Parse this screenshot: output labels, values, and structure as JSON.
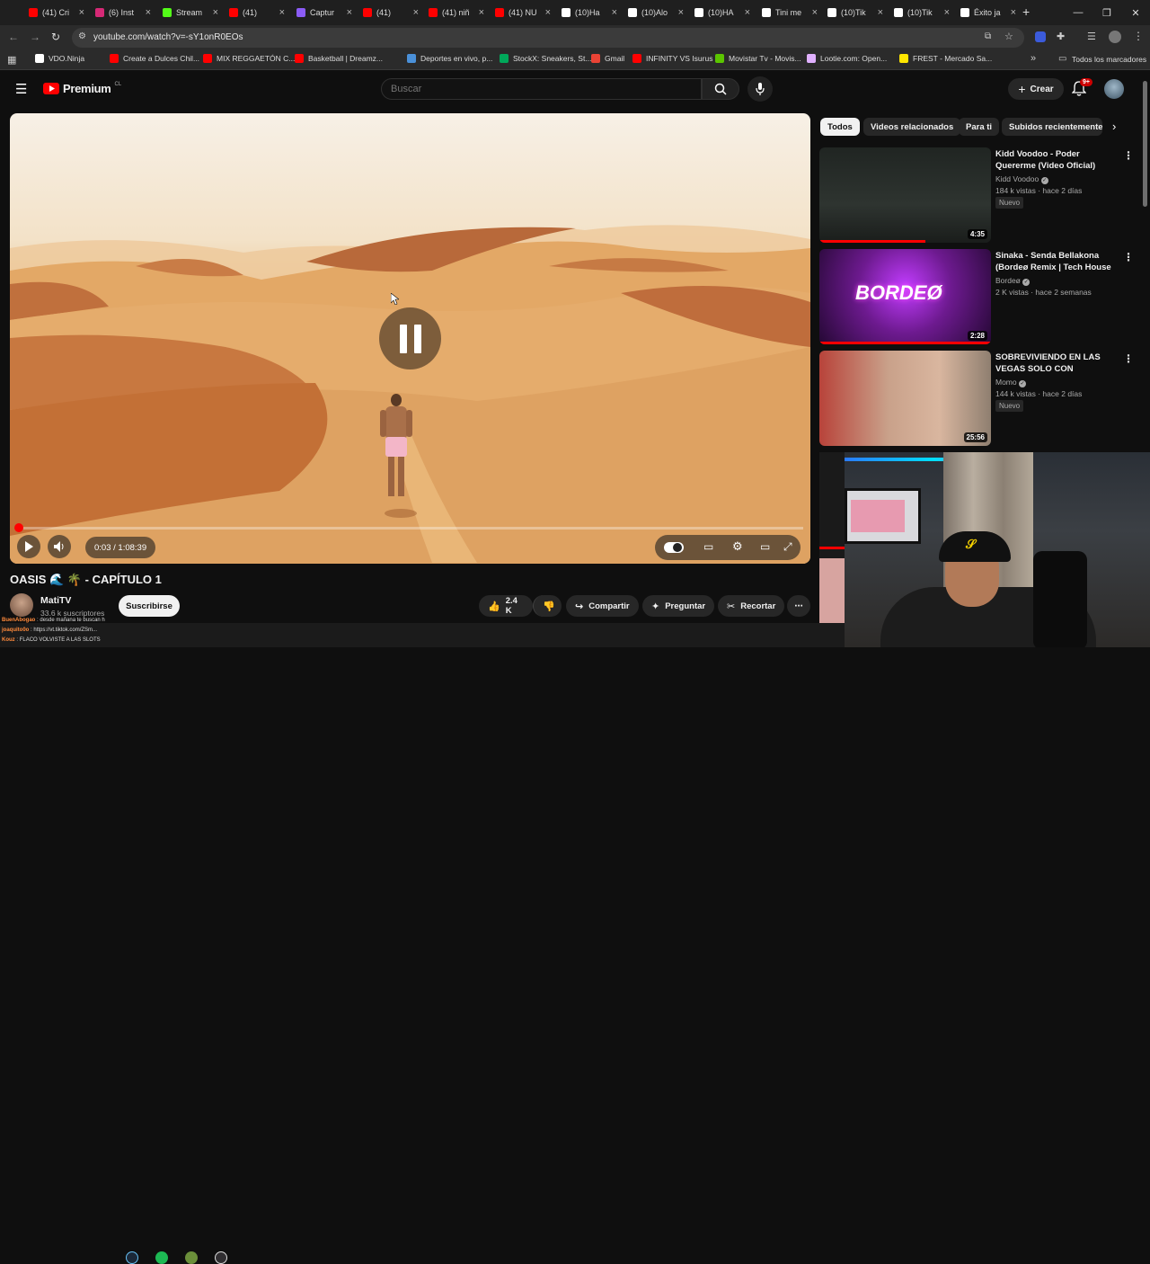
{
  "browser": {
    "tabs": [
      {
        "label": "(41) Cri",
        "color": "#ff0000"
      },
      {
        "label": "(6) Inst",
        "color": "#d62976"
      },
      {
        "label": "Stream",
        "color": "#53fc18"
      },
      {
        "label": "(41)",
        "color": "#ff0000"
      },
      {
        "label": "Captur",
        "color": "#8b5cf6"
      },
      {
        "label": "(41)",
        "color": "#ff0000"
      },
      {
        "label": "(41) niñ",
        "color": "#ff0000"
      },
      {
        "label": "(41) NU",
        "color": "#ff0000"
      },
      {
        "label": "(10)Ha",
        "color": "#ffffff"
      },
      {
        "label": "(10)Alo",
        "color": "#ffffff"
      },
      {
        "label": "(10)HA",
        "color": "#ffffff"
      },
      {
        "label": "Tini me",
        "color": "#ffffff"
      },
      {
        "label": "(10)Tik",
        "color": "#ffffff"
      },
      {
        "label": "(10)Tik",
        "color": "#ffffff"
      },
      {
        "label": "Éxito ja",
        "color": "#ffffff"
      }
    ],
    "new_tab": "+",
    "url": "youtube.com/watch?v=-sY1onR0EOs",
    "bookmarks": [
      {
        "label": "VDO.Ninja",
        "color": "#ffffff"
      },
      {
        "label": "Create a Dulces Chil...",
        "color": "#ff0000"
      },
      {
        "label": "MIX REGGAETÓN C...",
        "color": "#ff0000"
      },
      {
        "label": "Basketball | Dreamz...",
        "color": "#ff0000"
      },
      {
        "label": "Deportes en vivo, p...",
        "color": "#4a90d9"
      },
      {
        "label": "StockX: Sneakers, St...",
        "color": "#00a85a"
      },
      {
        "label": "Gmail",
        "color": "#ea4335"
      },
      {
        "label": "INFINITY VS Isurus",
        "color": "#ff0000"
      },
      {
        "label": "Movistar Tv - Movis...",
        "color": "#5bc500"
      },
      {
        "label": "Lootie.com: Open...",
        "color": "#e0b0ff"
      },
      {
        "label": "FREST - Mercado Sa...",
        "color": "#ffe600"
      }
    ],
    "bookmarks_more": "»",
    "all_bookmarks": "Todos los marcadores"
  },
  "youtube": {
    "logo_text": "Premium",
    "logo_region": "CL",
    "search_placeholder": "Buscar",
    "create_label": "Crear",
    "notif_badge": "9+"
  },
  "player": {
    "time": "0:03 / 1:08:39",
    "progress": 0.001
  },
  "video": {
    "title": "OASIS 🌊 🌴 - CAPÍTULO 1",
    "channel": "MatiTV",
    "subscribers": "33.6 k suscriptores",
    "subscribe_label": "Suscribirse",
    "likes": "2.4 K",
    "share_label": "Compartir",
    "ask_label": "Preguntar",
    "clip_label": "Recortar"
  },
  "sidebar": {
    "chips": [
      "Todos",
      "Videos relacionados",
      "Para ti",
      "Subidos recientemente"
    ],
    "recommendations": [
      {
        "title": "Kidd Voodoo - Poder Quererme (Video Oficial)",
        "channel": "Kidd Voodoo",
        "meta": "184 k vistas · hace 2 días",
        "badge": "Nuevo",
        "duration": "4:35",
        "watched": 0.62
      },
      {
        "title": "Sinaka - Senda Bellakona (Bordeø Remix | Tech House ...",
        "channel": "Bordeø",
        "meta": "2 K vistas · hace 2 semanas",
        "badge": "",
        "duration": "2:28",
        "watched": 1.0,
        "thumb_text": "BORDEØ"
      },
      {
        "title": "SOBREVIVIENDO EN LAS VEGAS SOLO CON APUESTAS",
        "channel": "Momo",
        "meta": "144 k vistas · hace 2 días",
        "badge": "Nuevo",
        "duration": "25:56",
        "watched": 0
      }
    ]
  },
  "chat": [
    {
      "user": "BuenAbogao",
      "text": "desde mañana te buscan h"
    },
    {
      "user": "joaquito0o",
      "text": "https://vt.tiktok.com/ZSm..."
    },
    {
      "user": "Kouz",
      "text": "FLACO VOLVISTE A LAS SLOTS"
    }
  ]
}
